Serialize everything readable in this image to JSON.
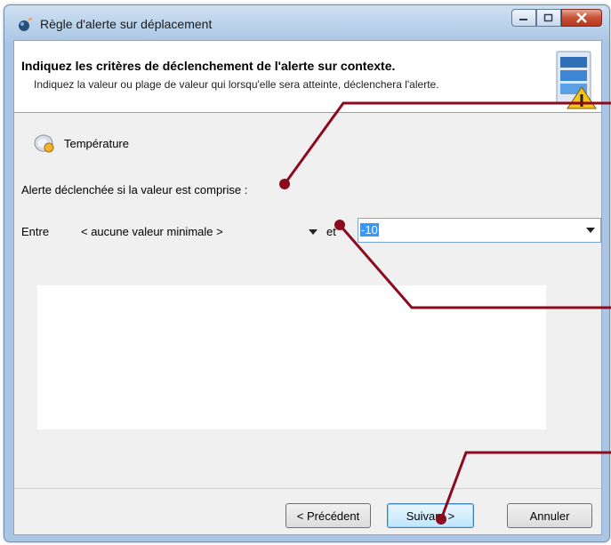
{
  "window": {
    "title": "Règle d'alerte sur déplacement",
    "caption_buttons": [
      "minimize",
      "maximize",
      "close"
    ]
  },
  "header": {
    "title": "Indiquez les critères de déclenchement de l'alerte sur contexte.",
    "description": "Indiquez la valeur ou plage de valeur qui lorsqu'elle sera atteinte, déclenchera l'alerte.",
    "icon": "database-warning-icon"
  },
  "section": {
    "label": "Température",
    "icon": "thermometer-sensor-icon"
  },
  "condition": {
    "label": "Alerte déclenchée si la valeur est comprise :",
    "between_label": "Entre",
    "and_label": "et",
    "min_value": "< aucune valeur minimale >",
    "max_value": "-10"
  },
  "buttons": {
    "previous": "< Précédent",
    "next": "Suivant >",
    "cancel": "Annuler"
  },
  "colors": {
    "callout": "#8b0a1e",
    "accent": "#3399ff"
  }
}
